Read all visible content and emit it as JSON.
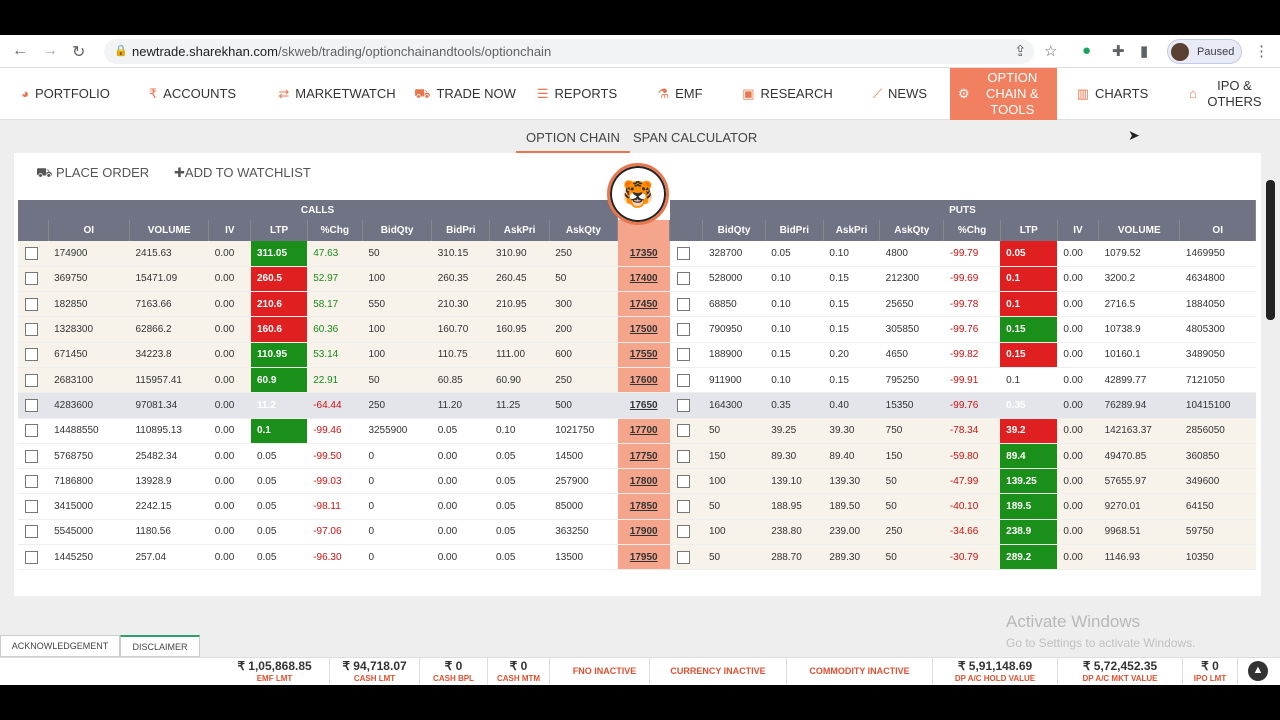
{
  "browser": {
    "url_host": "newtrade.sharekhan.com",
    "url_path": "/skweb/trading/optionchainandtools/optionchain",
    "profile_status": "Paused"
  },
  "nav": {
    "items": [
      {
        "label": "PORTFOLIO",
        "icon": "pie-chart-icon",
        "glyph": "◕"
      },
      {
        "label": "ACCOUNTS",
        "icon": "rupee-icon",
        "glyph": "₹"
      },
      {
        "label": "MARKETWATCH",
        "icon": "refresh-arrows-icon",
        "glyph": "⇄"
      },
      {
        "label": "TRADE NOW",
        "icon": "cart-icon",
        "glyph": "⛟"
      },
      {
        "label": "REPORTS",
        "icon": "list-icon",
        "glyph": "☰"
      },
      {
        "label": "EMF",
        "icon": "flask-icon",
        "glyph": "⚗"
      },
      {
        "label": "RESEARCH",
        "icon": "briefcase-icon",
        "glyph": "▣"
      },
      {
        "label": "NEWS",
        "icon": "trend-icon",
        "glyph": "📈"
      },
      {
        "label": "OPTION CHAIN & TOOLS",
        "icon": "options-icon",
        "glyph": "⚙"
      },
      {
        "label": "CHARTS",
        "icon": "bar-chart-icon",
        "glyph": "▥"
      },
      {
        "label": "IPO & OTHERS",
        "icon": "bank-icon",
        "glyph": "🏛"
      }
    ]
  },
  "subtabs": {
    "option_chain": "OPTION CHAIN",
    "span_calculator": "SPAN CALCULATOR"
  },
  "actions": {
    "place_order": "PLACE ORDER",
    "add_watchlist": "ADD TO WATCHLIST"
  },
  "table": {
    "calls_label": "CALLS",
    "puts_label": "PUTS",
    "call_headers": [
      "OI",
      "VOLUME",
      "IV",
      "LTP",
      "%Chg",
      "BidQty",
      "BidPri",
      "AskPri",
      "AskQty"
    ],
    "put_headers": [
      "BidQty",
      "BidPri",
      "AskPri",
      "AskQty",
      "%Chg",
      "LTP",
      "IV",
      "VOLUME",
      "OI"
    ],
    "rows": [
      {
        "strike": "17350",
        "call": [
          "174900",
          "2415.63",
          "0.00",
          "311.05",
          "47.63",
          "50",
          "310.15",
          "310.90",
          "250"
        ],
        "call_ltp": "green",
        "put": [
          "328700",
          "0.05",
          "0.10",
          "4800",
          "-99.79",
          "0.05",
          "0.00",
          "1079.52",
          "1469950"
        ],
        "put_ltp": "red",
        "itm": "call"
      },
      {
        "strike": "17400",
        "call": [
          "369750",
          "15471.09",
          "0.00",
          "260.5",
          "52.97",
          "100",
          "260.35",
          "260.45",
          "50"
        ],
        "call_ltp": "red",
        "put": [
          "528000",
          "0.10",
          "0.15",
          "212300",
          "-99.69",
          "0.1",
          "0.00",
          "3200.2",
          "4634800"
        ],
        "put_ltp": "red",
        "itm": "call"
      },
      {
        "strike": "17450",
        "call": [
          "182850",
          "7163.66",
          "0.00",
          "210.6",
          "58.17",
          "550",
          "210.30",
          "210.95",
          "300"
        ],
        "call_ltp": "red",
        "put": [
          "68850",
          "0.10",
          "0.15",
          "25650",
          "-99.78",
          "0.1",
          "0.00",
          "2716.5",
          "1884050"
        ],
        "put_ltp": "red",
        "itm": "call"
      },
      {
        "strike": "17500",
        "call": [
          "1328300",
          "62866.2",
          "0.00",
          "160.6",
          "60.36",
          "100",
          "160.70",
          "160.95",
          "200"
        ],
        "call_ltp": "red",
        "put": [
          "790950",
          "0.10",
          "0.15",
          "305850",
          "-99.76",
          "0.15",
          "0.00",
          "10738.9",
          "4805300"
        ],
        "put_ltp": "green",
        "itm": "call"
      },
      {
        "strike": "17550",
        "call": [
          "671450",
          "34223.8",
          "0.00",
          "110.95",
          "53.14",
          "100",
          "110.75",
          "111.00",
          "600"
        ],
        "call_ltp": "green",
        "put": [
          "188900",
          "0.15",
          "0.20",
          "4650",
          "-99.82",
          "0.15",
          "0.00",
          "10160.1",
          "3489050"
        ],
        "put_ltp": "red",
        "itm": "call"
      },
      {
        "strike": "17600",
        "call": [
          "2683100",
          "115957.41",
          "0.00",
          "60.9",
          "22.91",
          "50",
          "60.85",
          "60.90",
          "250"
        ],
        "call_ltp": "green",
        "put": [
          "911900",
          "0.10",
          "0.15",
          "795250",
          "-99.91",
          "0.1",
          "0.00",
          "42899.77",
          "7121050"
        ],
        "put_ltp": "none",
        "itm": "call"
      },
      {
        "strike": "17650",
        "call": [
          "4283600",
          "97081.34",
          "0.00",
          "11.2",
          "-64.44",
          "250",
          "11.20",
          "11.25",
          "500"
        ],
        "call_ltp": "red",
        "put": [
          "164300",
          "0.35",
          "0.40",
          "15350",
          "-99.76",
          "0.35",
          "0.00",
          "76289.94",
          "10415100"
        ],
        "put_ltp": "red",
        "itm": "hl"
      },
      {
        "strike": "17700",
        "call": [
          "14488550",
          "110895.13",
          "0.00",
          "0.1",
          "-99.46",
          "3255900",
          "0.05",
          "0.10",
          "1021750"
        ],
        "call_ltp": "green",
        "put": [
          "50",
          "39.25",
          "39.30",
          "750",
          "-78.34",
          "39.2",
          "0.00",
          "142163.37",
          "2856050"
        ],
        "put_ltp": "red",
        "itm": "put"
      },
      {
        "strike": "17750",
        "call": [
          "5768750",
          "25482.34",
          "0.00",
          "0.05",
          "-99.50",
          "0",
          "0.00",
          "0.05",
          "14500"
        ],
        "call_ltp": "none",
        "put": [
          "150",
          "89.30",
          "89.40",
          "150",
          "-59.80",
          "89.4",
          "0.00",
          "49470.85",
          "360850"
        ],
        "put_ltp": "green",
        "itm": "put"
      },
      {
        "strike": "17800",
        "call": [
          "7186800",
          "13928.9",
          "0.00",
          "0.05",
          "-99.03",
          "0",
          "0.00",
          "0.05",
          "257900"
        ],
        "call_ltp": "none",
        "put": [
          "100",
          "139.10",
          "139.30",
          "50",
          "-47.99",
          "139.25",
          "0.00",
          "57655.97",
          "349600"
        ],
        "put_ltp": "green",
        "itm": "put"
      },
      {
        "strike": "17850",
        "call": [
          "3415000",
          "2242.15",
          "0.00",
          "0.05",
          "-98.11",
          "0",
          "0.00",
          "0.05",
          "85000"
        ],
        "call_ltp": "none",
        "put": [
          "50",
          "188.95",
          "189.50",
          "50",
          "-40.10",
          "189.5",
          "0.00",
          "9270.01",
          "64150"
        ],
        "put_ltp": "green",
        "itm": "put"
      },
      {
        "strike": "17900",
        "call": [
          "5545000",
          "1180.56",
          "0.00",
          "0.05",
          "-97.06",
          "0",
          "0.00",
          "0.05",
          "363250"
        ],
        "call_ltp": "none",
        "put": [
          "100",
          "238.80",
          "239.00",
          "250",
          "-34.66",
          "238.9",
          "0.00",
          "9968.51",
          "59750"
        ],
        "put_ltp": "green",
        "itm": "put"
      },
      {
        "strike": "17950",
        "call": [
          "1445250",
          "257.04",
          "0.00",
          "0.05",
          "-96.30",
          "0",
          "0.00",
          "0.05",
          "13500"
        ],
        "call_ltp": "none",
        "put": [
          "50",
          "288.70",
          "289.30",
          "50",
          "-30.79",
          "289.2",
          "0.00",
          "1146.93",
          "10350"
        ],
        "put_ltp": "green",
        "itm": "put"
      }
    ]
  },
  "bottom_tabs": {
    "acknowledgement": "ACKNOWLEDGEMENT",
    "disclaimer": "DISCLAIMER"
  },
  "watermark": {
    "line1": "Activate Windows",
    "line2": "Go to Settings to activate Windows."
  },
  "status": [
    {
      "value": "₹ 1,05,868.85",
      "label": "EMF LMT"
    },
    {
      "value": "₹ 94,718.07",
      "label": "CASH LMT"
    },
    {
      "value": "₹ 0",
      "label": "CASH BPL"
    },
    {
      "value": "₹ 0",
      "label": "CASH MTM"
    },
    {
      "value": "",
      "label": "FNO INACTIVE"
    },
    {
      "value": "",
      "label": "CURRENCY INACTIVE"
    },
    {
      "value": "",
      "label": "COMMODITY INACTIVE"
    },
    {
      "value": "₹ 5,91,148.69",
      "label": "DP A/C HOLD VALUE"
    },
    {
      "value": "₹ 5,72,452.35",
      "label": "DP A/C MKT VALUE"
    },
    {
      "value": "₹ 0",
      "label": "IPO LMT"
    }
  ]
}
